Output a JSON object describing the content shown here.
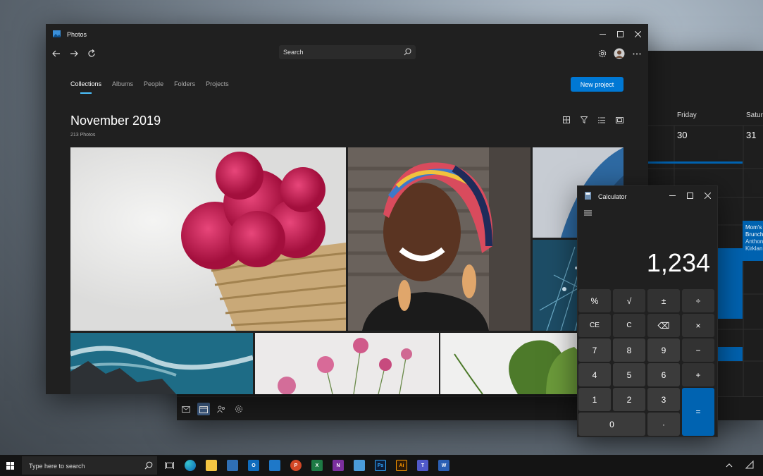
{
  "calendar": {
    "day_headers": [
      "Friday",
      "Saturday"
    ],
    "day_numbers": [
      "30",
      "31"
    ],
    "event": {
      "title": "Mom's",
      "title2": "Brunch",
      "line3": "Anthon",
      "line4": "Kirklan"
    }
  },
  "photos": {
    "app_title": "Photos",
    "search_placeholder": "Search",
    "tabs": [
      "Collections",
      "Albums",
      "People",
      "Folders",
      "Projects"
    ],
    "new_project_label": "New project",
    "month_heading": "November 2019",
    "photo_count": "213 Photos"
  },
  "calculator": {
    "app_title": "Calculator",
    "display": "1,234",
    "keys": [
      "%",
      "√",
      "±",
      "÷",
      "CE",
      "C",
      "⌫",
      "×",
      "7",
      "8",
      "9",
      "−",
      "4",
      "5",
      "6",
      "+",
      "1",
      "2",
      "3",
      "0",
      "·",
      "="
    ]
  },
  "taskbar": {
    "search_placeholder": "Type here to search",
    "apps": [
      "task-view",
      "edge",
      "file-explorer",
      "store",
      "outlook",
      "calendar",
      "powerpoint",
      "excel",
      "onenote",
      "photos",
      "photoshop",
      "illustrator",
      "teams",
      "word"
    ]
  },
  "colors": {
    "accent": "#0078d4",
    "window_bg": "#202020",
    "tab_indicator": "#4cc2ff"
  }
}
